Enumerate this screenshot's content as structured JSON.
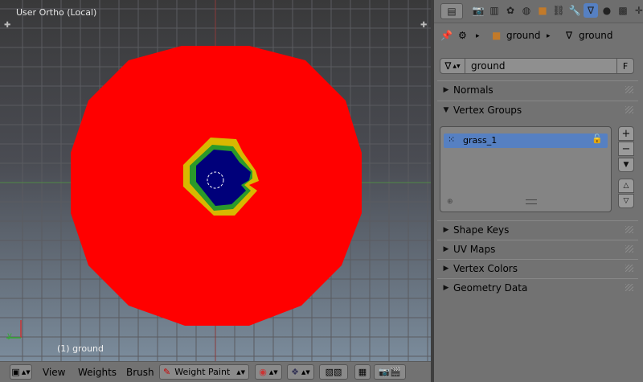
{
  "viewport": {
    "title": "User Ortho (Local)",
    "object_label": "(1) ground",
    "axis_label": "y"
  },
  "header": {
    "menu_view": "View",
    "menu_weights": "Weights",
    "menu_brush": "Brush",
    "mode_label": "Weight Paint"
  },
  "properties": {
    "breadcrumb_object": "ground",
    "breadcrumb_mesh": "ground",
    "mesh_name": "ground",
    "fake_user_label": "F",
    "panels": {
      "normals": "Normals",
      "vertex_groups": "Vertex Groups",
      "shape_keys": "Shape Keys",
      "uv_maps": "UV Maps",
      "vertex_colors": "Vertex Colors",
      "geometry_data": "Geometry Data"
    },
    "vertex_group_items": [
      "grass_1"
    ]
  },
  "colors": {
    "weight_zero": "#ff0000",
    "weight_full": "#00007a",
    "selection": "#5680c2"
  },
  "icons": [
    "editor-type-icon",
    "render-icon",
    "scene-icon",
    "world-icon",
    "object-icon",
    "constraints-icon",
    "modifier-icon",
    "mesh-data-icon",
    "material-icon",
    "texture-icon",
    "physics-icon",
    "pin-icon",
    "plus-icon",
    "minus-icon",
    "chevron-up-icon",
    "chevron-down-icon"
  ]
}
